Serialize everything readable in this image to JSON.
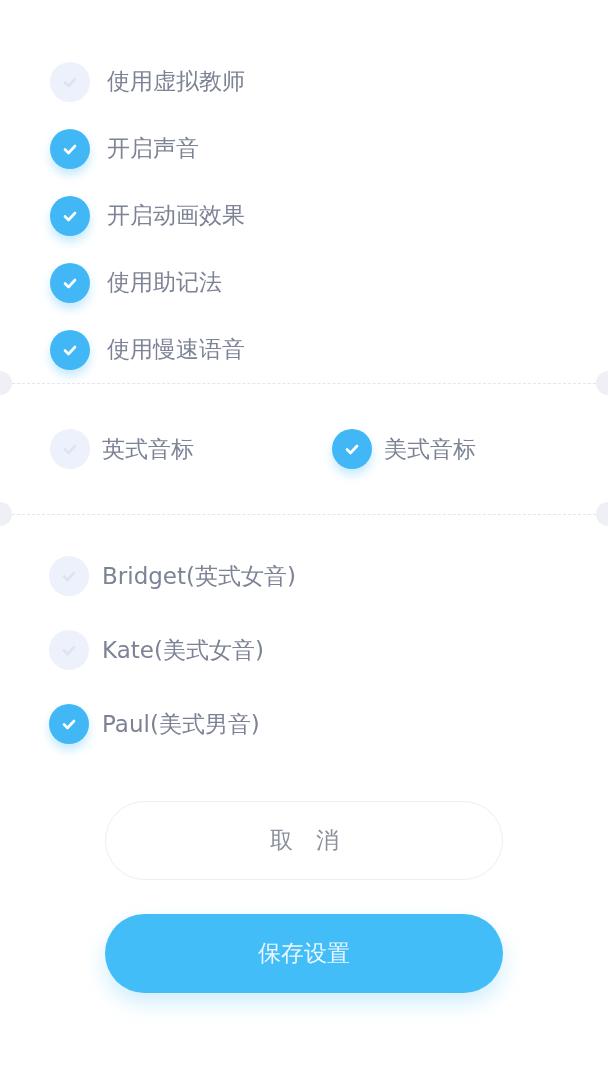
{
  "options": [
    {
      "label": "使用虚拟教师",
      "checked": false
    },
    {
      "label": "开启声音",
      "checked": true
    },
    {
      "label": "开启动画效果",
      "checked": true
    },
    {
      "label": "使用助记法",
      "checked": true
    },
    {
      "label": "使用慢速语音",
      "checked": true
    }
  ],
  "phonetics": [
    {
      "label": "英式音标",
      "selected": false
    },
    {
      "label": "美式音标",
      "selected": true
    }
  ],
  "voices": [
    {
      "label": "Bridget(英式女音)",
      "selected": false
    },
    {
      "label": "Kate(美式女音)",
      "selected": false
    },
    {
      "label": "Paul(美式男音)",
      "selected": true
    }
  ],
  "buttons": [
    {
      "kind": "cancel",
      "label": "取　消"
    },
    {
      "kind": "save",
      "label": "保存设置"
    }
  ]
}
